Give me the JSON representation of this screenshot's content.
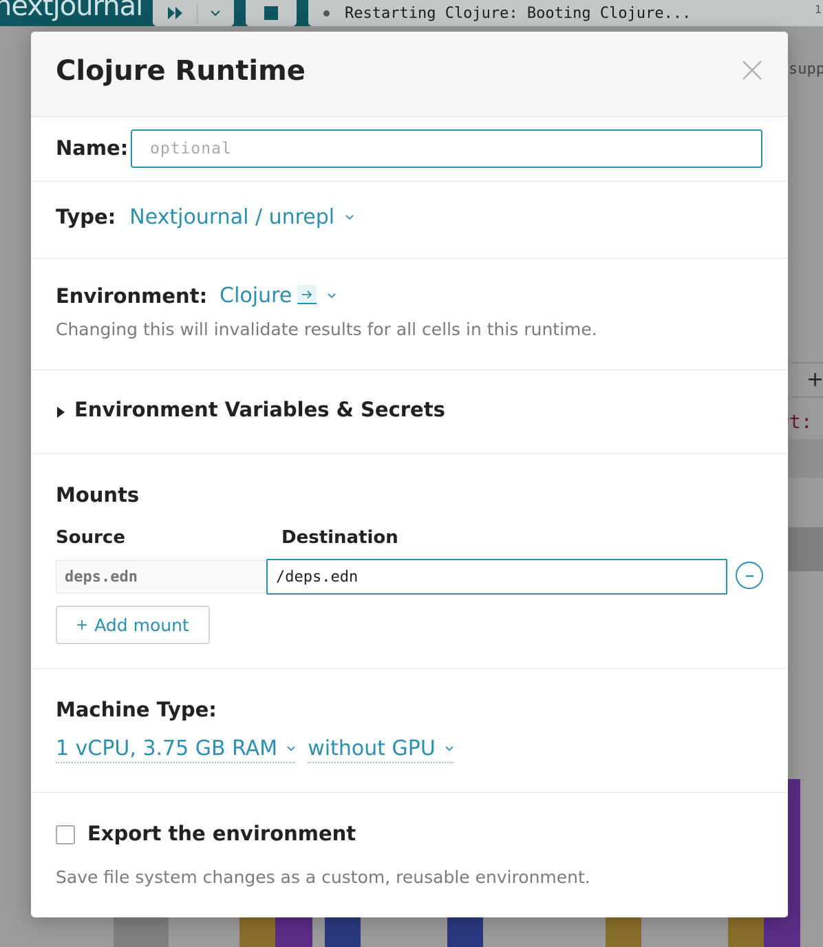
{
  "background": {
    "logo": "nextjournal",
    "status_text": "Restarting Clojure: Booting Clojure...",
    "side_text": "supp",
    "code_fragment": "rt:",
    "page_marker": "1"
  },
  "modal": {
    "title": "Clojure Runtime",
    "name": {
      "label": "Name:",
      "placeholder": "optional",
      "value": ""
    },
    "type": {
      "label": "Type:",
      "value": "Nextjournal / unrepl"
    },
    "environment": {
      "label": "Environment:",
      "value": "Clojure",
      "note": "Changing this will invalidate results for all cells in this runtime."
    },
    "env_vars": {
      "label": "Environment Variables & Secrets"
    },
    "mounts": {
      "heading": "Mounts",
      "source_header": "Source",
      "destination_header": "Destination",
      "rows": [
        {
          "source_placeholder": "deps.edn",
          "destination": "/deps.edn"
        }
      ],
      "add_label": "Add mount"
    },
    "machine": {
      "label": "Machine Type:",
      "cpu": "1 vCPU, 3.75 GB RAM",
      "gpu": "without GPU"
    },
    "export": {
      "label": "Export the environment",
      "note": "Save file system changes as a custom, reusable environment.",
      "checked": false
    }
  },
  "colors": {
    "accent": "#2a8fb0",
    "topbar": "#0f5660",
    "overlay": "#9a9a9a"
  }
}
